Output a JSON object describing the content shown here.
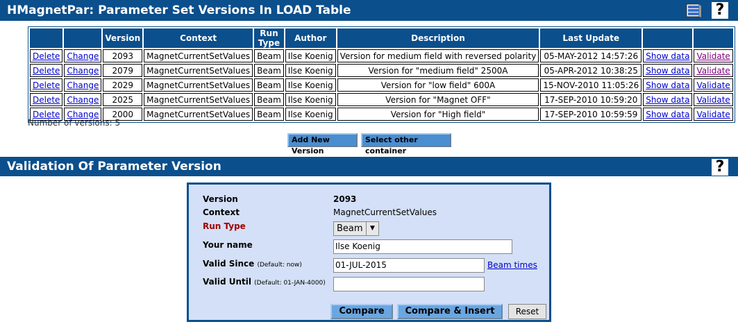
{
  "header": {
    "title": "HMagnetPar: Parameter Set Versions In LOAD Table",
    "help": "?"
  },
  "table": {
    "columns": [
      "",
      "",
      "Version",
      "Context",
      "Run Type",
      "Author",
      "Description",
      "Last Update",
      "",
      ""
    ],
    "rows": [
      {
        "delete": "Delete",
        "change": "Change",
        "version": "2093",
        "context": "MagnetCurrentSetValues",
        "run_type": "Beam",
        "author": "Ilse Koenig",
        "description": "Version for medium field with reversed polarity",
        "last_update": "05-MAY-2012 14:57:26",
        "show": "Show data",
        "validate": "Validate"
      },
      {
        "delete": "Delete",
        "change": "Change",
        "version": "2079",
        "context": "MagnetCurrentSetValues",
        "run_type": "Beam",
        "author": "Ilse Koenig",
        "description": "Version for \"medium field\" 2500A",
        "last_update": "05-APR-2012 10:38:25",
        "show": "Show data",
        "validate": "Validate"
      },
      {
        "delete": "Delete",
        "change": "Change",
        "version": "2029",
        "context": "MagnetCurrentSetValues",
        "run_type": "Beam",
        "author": "Ilse Koenig",
        "description": "Version for \"low field\" 600A",
        "last_update": "15-NOV-2010 11:05:26",
        "show": "Show data",
        "validate": "Validate"
      },
      {
        "delete": "Delete",
        "change": "Change",
        "version": "2025",
        "context": "MagnetCurrentSetValues",
        "run_type": "Beam",
        "author": "Ilse Koenig",
        "description": "Version for \"Magnet OFF\"",
        "last_update": "17-SEP-2010 10:59:20",
        "show": "Show data",
        "validate": "Validate"
      },
      {
        "delete": "Delete",
        "change": "Change",
        "version": "2000",
        "context": "MagnetCurrentSetValues",
        "run_type": "Beam",
        "author": "Ilse Koenig",
        "description": "Version for \"High field\"",
        "last_update": "17-SEP-2010 10:59:59",
        "show": "Show data",
        "validate": "Validate"
      }
    ],
    "count_text": "Number of versions: 5"
  },
  "actions": {
    "add_new": "Add New Version",
    "select_other": "Select other container"
  },
  "validation": {
    "title": "Validation Of Parameter Version",
    "help": "?",
    "version_label": "Version",
    "version_value": "2093",
    "context_label": "Context",
    "context_value": "MagnetCurrentSetValues",
    "run_type_label": "Run Type",
    "run_type_value": "Beam",
    "name_label": "Your name",
    "name_value": "Ilse Koenig",
    "since_label": "Valid Since",
    "since_hint": "(Default: now)",
    "since_value": "01-JUL-2015",
    "beam_times": "Beam times",
    "until_label": "Valid Until",
    "until_hint": "(Default: 01-JAN-4000)",
    "until_value": "",
    "compare": "Compare",
    "compare_insert": "Compare & Insert",
    "reset": "Reset"
  },
  "colors": {
    "header_bg": "#0b4f8c",
    "panel_bg": "#d4e0f7",
    "run_type_label": "#a00000",
    "link": "#0000cc",
    "visited_link": "#800080"
  },
  "icons": [
    "book-icon",
    "help-icon"
  ]
}
